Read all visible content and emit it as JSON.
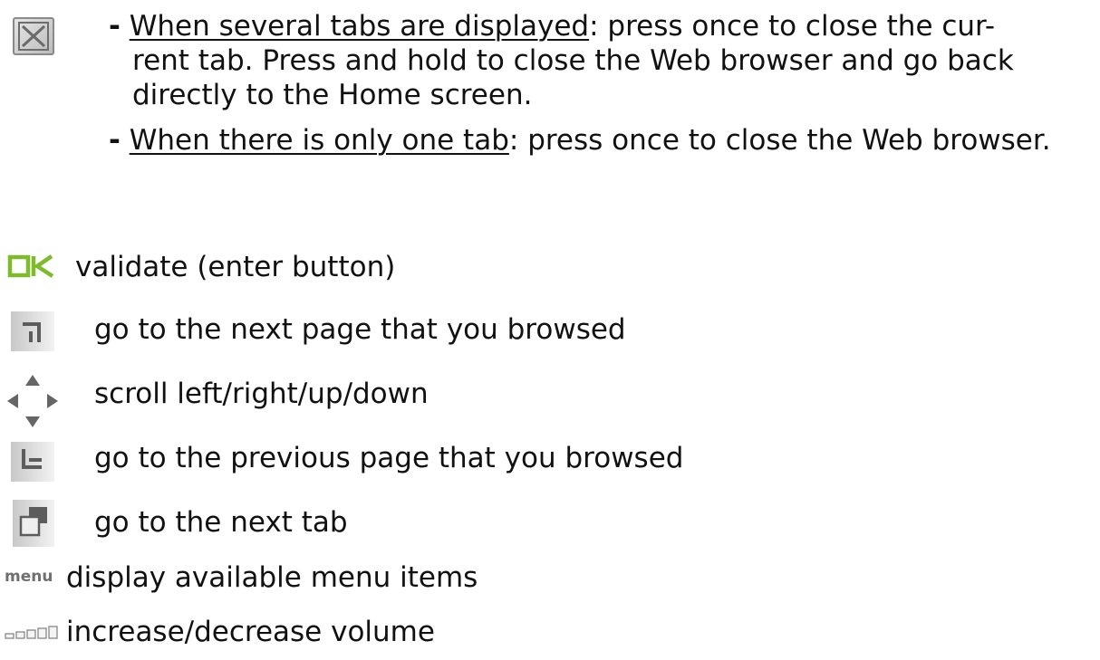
{
  "close_section": {
    "icon": "close-x-icon",
    "dash": "-",
    "bullet1": {
      "underlined": "When several tabs are displayed",
      "rest_line1": ": press once to close the cur-",
      "line2": "rent tab. Press and hold to close the Web browser and go back",
      "line3": "directly to the Home screen."
    },
    "bullet2": {
      "underlined": "When there is only one tab",
      "rest": ": press once to close the Web browser."
    }
  },
  "items": [
    {
      "icon": "ok-icon",
      "label": "validate (enter button)"
    },
    {
      "icon": "next-page-icon",
      "label": "go to the next page that you browsed"
    },
    {
      "icon": "arrows-icon",
      "label": "scroll left/right/up/down"
    },
    {
      "icon": "previous-page-icon",
      "label": "go to the previous page that you browsed"
    },
    {
      "icon": "next-tab-icon",
      "label": "go to the next tab"
    },
    {
      "icon": "menu-icon",
      "label": "display available menu items"
    },
    {
      "icon": "volume-icon",
      "label": "increase/decrease volume"
    }
  ],
  "icon_text": {
    "ok": "OK",
    "menu": "menu"
  },
  "colors": {
    "ok_green": "#7dbb2a",
    "icon_gray": "#9a9a9a",
    "icon_bg": "#e2e2e2"
  }
}
